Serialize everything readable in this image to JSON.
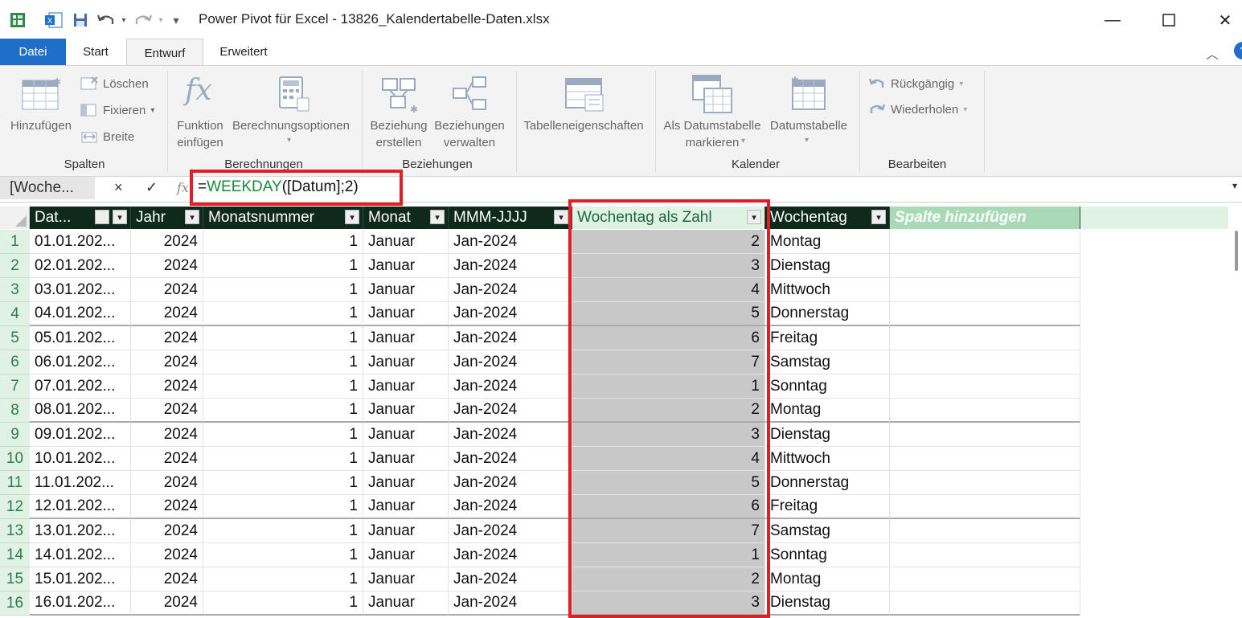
{
  "window": {
    "title": "Power Pivot für Excel - 13826_Kalendertabelle-Daten.xlsx"
  },
  "tabs": [
    {
      "label": "Datei"
    },
    {
      "label": "Start"
    },
    {
      "label": "Entwurf"
    },
    {
      "label": "Erweitert"
    }
  ],
  "ribbon": {
    "spalten": {
      "label": "Spalten",
      "hinzufuegen": "Hinzufügen",
      "loeschen": "Löschen",
      "fixieren": "Fixieren",
      "breite": "Breite"
    },
    "berechnungen": {
      "label": "Berechnungen",
      "funktion_line1": "Funktion",
      "funktion_line2": "einfügen",
      "optionen": "Berechnungsoptionen"
    },
    "beziehungen": {
      "label": "Beziehungen",
      "erstellen_line1": "Beziehung",
      "erstellen_line2": "erstellen",
      "verwalten_line1": "Beziehungen",
      "verwalten_line2": "verwalten"
    },
    "tabelle": {
      "eigenschaften": "Tabelleneigenschaften"
    },
    "kalender": {
      "label": "Kalender",
      "markieren_line1": "Als Datumstabelle",
      "markieren_line2": "markieren",
      "datumstabelle": "Datumstabelle"
    },
    "bearbeiten": {
      "label": "Bearbeiten",
      "rueckgaengig": "Rückgängig",
      "wiederholen": "Wiederholen"
    }
  },
  "formula": {
    "namebox": "[Woche...",
    "cancel": "×",
    "confirm": "✓",
    "fx": "fx",
    "eq": "=",
    "func": "WEEKDAY",
    "args": "([Datum];2)"
  },
  "grid": {
    "columns": [
      "Dat...",
      "Jahr",
      "Monatsnummer",
      "Monat",
      "MMM-JJJJ",
      "Wochentag als Zahl",
      "Wochentag",
      "Spalte hinzufügen"
    ],
    "rows": [
      [
        "1",
        "01.01.202...",
        "2024",
        "1",
        "Januar",
        "Jan-2024",
        "2",
        "Montag"
      ],
      [
        "2",
        "02.01.202...",
        "2024",
        "1",
        "Januar",
        "Jan-2024",
        "3",
        "Dienstag"
      ],
      [
        "3",
        "03.01.202...",
        "2024",
        "1",
        "Januar",
        "Jan-2024",
        "4",
        "Mittwoch"
      ],
      [
        "4",
        "04.01.202...",
        "2024",
        "1",
        "Januar",
        "Jan-2024",
        "5",
        "Donnerstag"
      ],
      [
        "5",
        "05.01.202...",
        "2024",
        "1",
        "Januar",
        "Jan-2024",
        "6",
        "Freitag"
      ],
      [
        "6",
        "06.01.202...",
        "2024",
        "1",
        "Januar",
        "Jan-2024",
        "7",
        "Samstag"
      ],
      [
        "7",
        "07.01.202...",
        "2024",
        "1",
        "Januar",
        "Jan-2024",
        "1",
        "Sonntag"
      ],
      [
        "8",
        "08.01.202...",
        "2024",
        "1",
        "Januar",
        "Jan-2024",
        "2",
        "Montag"
      ],
      [
        "9",
        "09.01.202...",
        "2024",
        "1",
        "Januar",
        "Jan-2024",
        "3",
        "Dienstag"
      ],
      [
        "10",
        "10.01.202...",
        "2024",
        "1",
        "Januar",
        "Jan-2024",
        "4",
        "Mittwoch"
      ],
      [
        "11",
        "11.01.202...",
        "2024",
        "1",
        "Januar",
        "Jan-2024",
        "5",
        "Donnerstag"
      ],
      [
        "12",
        "12.01.202...",
        "2024",
        "1",
        "Januar",
        "Jan-2024",
        "6",
        "Freitag"
      ],
      [
        "13",
        "13.01.202...",
        "2024",
        "1",
        "Januar",
        "Jan-2024",
        "7",
        "Samstag"
      ],
      [
        "14",
        "14.01.202...",
        "2024",
        "1",
        "Januar",
        "Jan-2024",
        "1",
        "Sonntag"
      ],
      [
        "15",
        "15.01.202...",
        "2024",
        "1",
        "Januar",
        "Jan-2024",
        "2",
        "Montag"
      ],
      [
        "16",
        "16.01.202...",
        "2024",
        "1",
        "Januar",
        "Jan-2024",
        "3",
        "Dienstag"
      ]
    ]
  },
  "colors": {
    "accent_blue": "#1f6fc9",
    "header_dark": "#0f2a1d",
    "highlight_red": "#e01e28",
    "formula_green": "#1a8a3a",
    "selected_gray": "#c8c8c8"
  }
}
